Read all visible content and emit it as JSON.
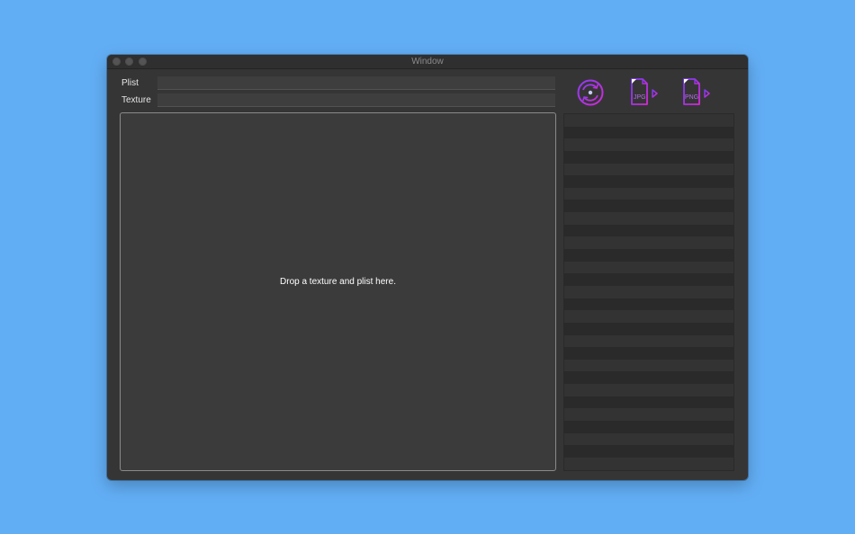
{
  "window": {
    "title": "Window"
  },
  "fields": {
    "plist_label": "Plist",
    "plist_value": "",
    "texture_label": "Texture",
    "texture_value": ""
  },
  "drop_zone": {
    "text": "Drop a texture and plist here."
  },
  "toolbar": {
    "convert_icon": "refresh-disc-icon",
    "jpg_label": "JPG",
    "png_label": "PNG",
    "accent_color": "#b02bf0"
  },
  "list": {
    "row_count": 29,
    "rows": []
  }
}
